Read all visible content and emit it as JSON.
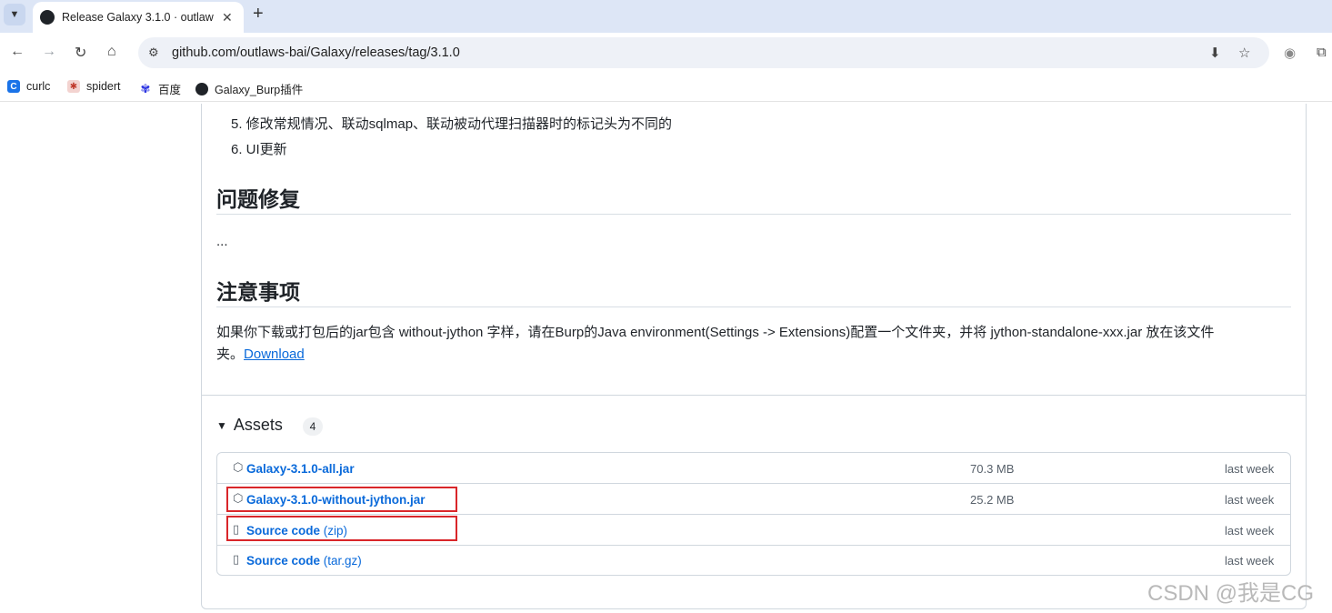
{
  "browser": {
    "tab_title": "Release Galaxy 3.1.0 · outlaw",
    "url": "github.com/outlaws-bai/Galaxy/releases/tag/3.1.0",
    "new_tab_symbol": "+",
    "bookmarks": [
      {
        "label": "curlc",
        "icon": "curlc-icon",
        "color": "#1a73e8"
      },
      {
        "label": "spidert",
        "icon": "spidert-icon",
        "color": "#c0392b"
      },
      {
        "label": "百度",
        "icon": "baidu-paw-icon",
        "color": "#2932e1"
      },
      {
        "label": "Galaxy_Burp插件",
        "icon": "github-icon",
        "color": "#1f2328"
      }
    ]
  },
  "release": {
    "list_items": [
      "5. 修改常规情况、联动sqlmap、联动被动代理扫描器时的标记头为不同的",
      "6. UI更新"
    ],
    "section_fixes_title": "问题修复",
    "section_fixes_body": "...",
    "section_notes_title": "注意事项",
    "notes_line1": "如果你下载或打包后的jar包含 without-jython 字样，请在Burp的Java environment(Settings -> Extensions)配置一个文件夹，并将 jython-standalone-xxx.jar 放在该文件",
    "notes_line2": "夹。",
    "notes_link": "Download"
  },
  "assets": {
    "heading": "Assets",
    "count": "4",
    "rows": [
      {
        "name": "Galaxy-3.1.0-all.jar",
        "suffix": "",
        "size": "70.3 MB",
        "when": "last week",
        "icon": "package-icon",
        "highlighted": false
      },
      {
        "name": "Galaxy-3.1.0-without-jython.jar",
        "suffix": "",
        "size": "25.2 MB",
        "when": "last week",
        "icon": "package-icon",
        "highlighted": true
      },
      {
        "name": "Source code",
        "suffix": " (zip)",
        "size": "",
        "when": "last week",
        "icon": "file-zip-icon",
        "highlighted": true
      },
      {
        "name": "Source code",
        "suffix": " (tar.gz)",
        "size": "",
        "when": "last week",
        "icon": "file-zip-icon",
        "highlighted": false
      }
    ]
  },
  "watermark": "CSDN @我是CG",
  "colors": {
    "link": "#0969da",
    "highlight": "#d9262a"
  }
}
